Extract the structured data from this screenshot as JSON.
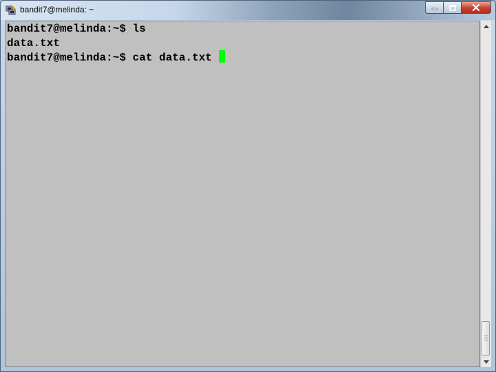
{
  "window": {
    "title": "bandit7@melinda: ~",
    "app_icon": "putty-icon",
    "controls": {
      "minimize_icon": "minimize-icon",
      "maximize_icon": "maximize-icon",
      "close_icon": "close-icon"
    }
  },
  "terminal": {
    "lines": [
      "bandit7@melinda:~$ ls",
      "data.txt",
      "bandit7@melinda:~$ cat data.txt "
    ],
    "cursor_color": "#00ff00",
    "background_color": "#c0c0c0",
    "text_color": "#000000"
  },
  "scrollbar": {
    "up_icon": "scroll-up-arrow-icon",
    "down_icon": "scroll-down-arrow-icon"
  }
}
